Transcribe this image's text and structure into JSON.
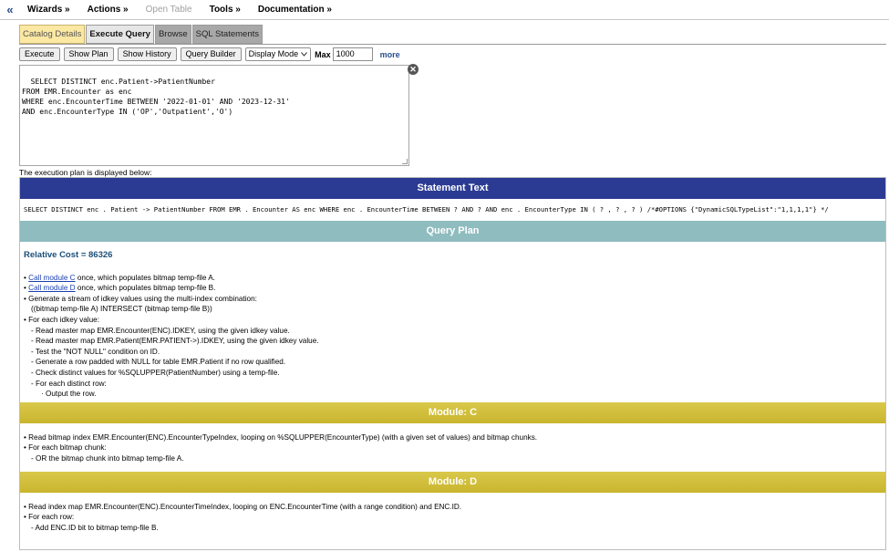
{
  "menu": {
    "collapse_glyph": "«",
    "items": [
      "Wizards »",
      "Actions »",
      "Open Table",
      "Tools »",
      "Documentation »"
    ]
  },
  "tabs": [
    "Catalog Details",
    "Execute Query",
    "Browse",
    "SQL Statements"
  ],
  "toolbar": {
    "execute": "Execute",
    "show_plan": "Show Plan",
    "show_history": "Show History",
    "query_builder": "Query Builder",
    "display_mode": "Display Mode",
    "max_label": "Max",
    "max_value": "1000",
    "more": "more"
  },
  "editor": {
    "sql": "SELECT DISTINCT enc.Patient->PatientNumber\nFROM EMR.Encounter as enc\nWHERE enc.EncounterTime BETWEEN '2022-01-01' AND '2023-12-31'\nAND enc.EncounterType IN ('OP','Outpatient','O')"
  },
  "plan_note": "The execution plan is displayed below:",
  "statement": {
    "header": "Statement Text",
    "text": "SELECT DISTINCT enc . Patient -> PatientNumber FROM EMR . Encounter AS enc WHERE enc . EncounterTime BETWEEN ? AND ? AND enc . EncounterType IN ( ? , ? , ? ) /*#OPTIONS {\"DynamicSQLTypeList\":\"1,1,1,1\"} */"
  },
  "plan": {
    "header": "Query Plan",
    "relative_cost": "Relative Cost = 86326",
    "call_c_link": "Call module C",
    "call_c_rest": " once, which populates bitmap temp-file A.",
    "call_d_link": "Call module D",
    "call_d_rest": " once, which populates bitmap temp-file B.",
    "lines": [
      "• Generate a stream of idkey values using the multi-index combination:",
      "((bitmap temp-file A) INTERSECT (bitmap temp-file B))",
      "• For each idkey value:",
      "- Read master map EMR.Encounter(ENC).IDKEY, using the given idkey value.",
      "- Read master map EMR.Patient(EMR.PATIENT->).IDKEY, using the given idkey value.",
      "- Test the \"NOT NULL\" condition on ID.",
      "- Generate a row padded with NULL for table EMR.Patient if no row qualified.",
      "- Check distinct values for %SQLUPPER(PatientNumber) using a temp-file.",
      "- For each distinct row:",
      "· Output the row."
    ]
  },
  "module_c": {
    "header": "Module: C",
    "lines": [
      "• Read bitmap index EMR.Encounter(ENC).EncounterTypeIndex, looping on %SQLUPPER(EncounterType) (with a given set of values) and bitmap chunks.",
      "• For each bitmap chunk:",
      "- OR the bitmap chunk into bitmap temp-file A."
    ]
  },
  "module_d": {
    "header": "Module: D",
    "lines": [
      "• Read index map EMR.Encounter(ENC).EncounterTimeIndex, looping on ENC.EncounterTime (with a range condition) and ENC.ID.",
      "• For each row:",
      "- Add ENC.ID bit to bitmap temp-file B."
    ]
  }
}
